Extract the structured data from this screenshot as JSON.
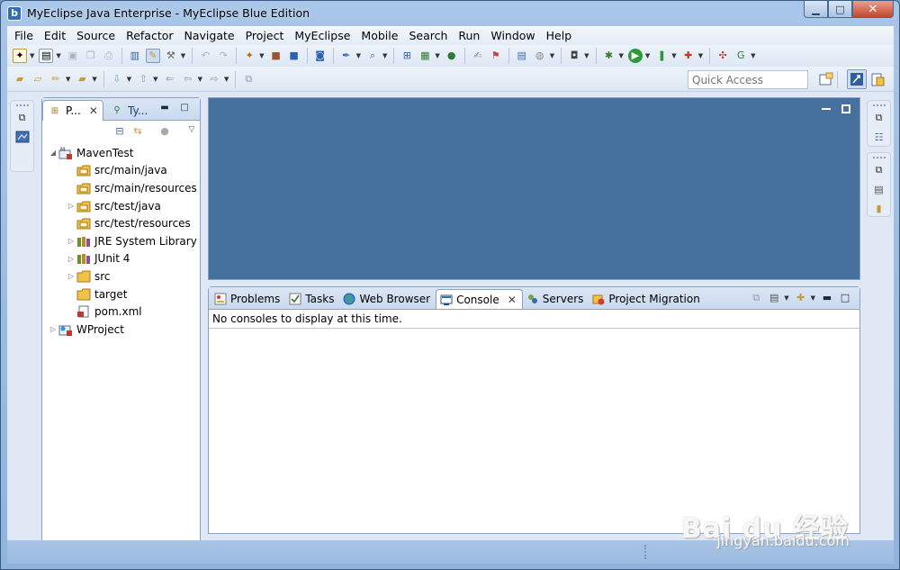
{
  "window": {
    "title": "MyEclipse Java Enterprise - MyEclipse Blue Edition",
    "minimize_glyph": "▁",
    "maximize_glyph": "□",
    "close_glyph": "✕"
  },
  "menubar": {
    "items": [
      "File",
      "Edit",
      "Source",
      "Refactor",
      "Navigate",
      "Project",
      "MyEclipse",
      "Mobile",
      "Search",
      "Run",
      "Window",
      "Help"
    ]
  },
  "toolbar": {
    "quick_access_placeholder": "Quick Access"
  },
  "package_explorer": {
    "tabs": [
      {
        "label": "P...",
        "active": true
      },
      {
        "label": "Ty...",
        "active": false
      }
    ],
    "tree": [
      {
        "label": "MavenTest",
        "indent": 0,
        "arrow": "◢",
        "icon": "maven-project-icon"
      },
      {
        "label": "src/main/java",
        "indent": 1,
        "arrow": "",
        "icon": "source-folder-icon"
      },
      {
        "label": "src/main/resources",
        "indent": 1,
        "arrow": "",
        "icon": "source-folder-icon"
      },
      {
        "label": "src/test/java",
        "indent": 1,
        "arrow": "▷",
        "icon": "source-folder-icon"
      },
      {
        "label": "src/test/resources",
        "indent": 1,
        "arrow": "",
        "icon": "source-folder-icon"
      },
      {
        "label": "JRE System Library",
        "indent": 1,
        "arrow": "▷",
        "icon": "library-icon"
      },
      {
        "label": "JUnit 4",
        "indent": 1,
        "arrow": "▷",
        "icon": "library-icon"
      },
      {
        "label": "src",
        "indent": 1,
        "arrow": "▷",
        "icon": "folder-icon"
      },
      {
        "label": "target",
        "indent": 1,
        "arrow": "",
        "icon": "folder-icon"
      },
      {
        "label": "pom.xml",
        "indent": 1,
        "arrow": "",
        "icon": "xml-file-icon"
      },
      {
        "label": "WProject",
        "indent": 0,
        "arrow": "▷",
        "icon": "web-project-icon"
      }
    ]
  },
  "console_panel": {
    "tabs": [
      {
        "label": "Problems",
        "icon": "problems-icon",
        "active": false
      },
      {
        "label": "Tasks",
        "icon": "tasks-icon",
        "active": false
      },
      {
        "label": "Web Browser",
        "icon": "globe-icon",
        "active": false
      },
      {
        "label": "Console",
        "icon": "console-icon",
        "active": true
      },
      {
        "label": "Servers",
        "icon": "servers-icon",
        "active": false
      },
      {
        "label": "Project Migration",
        "icon": "migration-icon",
        "active": false
      }
    ],
    "message": "No consoles to display at this time."
  },
  "watermark": {
    "main": "Bai du 经验",
    "sub": "jingyan.baidu.com"
  },
  "colors": {
    "editor_bg": "#46719f",
    "panel_border": "#8aa3c4",
    "status_bar": "#a9c4e4"
  }
}
